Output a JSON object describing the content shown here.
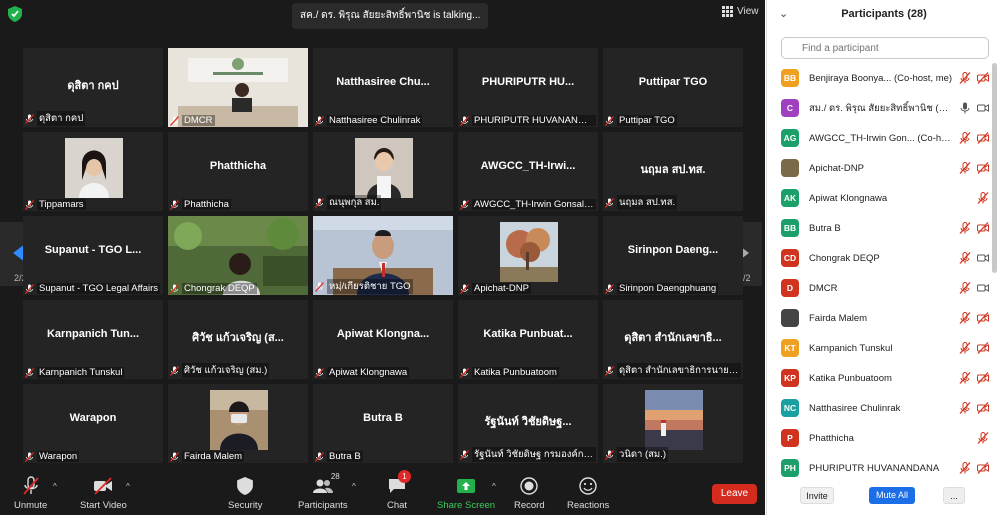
{
  "meeting": {
    "talking_text": "สค./ ดร. พิรุณ สัยยะสิทธิ์พานิช is  talking...",
    "view_label": "View",
    "page_left": "2/2",
    "page_right": "2/2"
  },
  "tiles": [
    {
      "big": "ดุสิตา กคป",
      "label": "ดุสิตา กคป",
      "video": false
    },
    {
      "big": "",
      "label": "DMCR",
      "video": "office"
    },
    {
      "big": "Natthasiree  Chu...",
      "label": "Natthasiree Chulinrak",
      "video": false
    },
    {
      "big": "PHURIPUTR  HU...",
      "label": "PHURIPUTR HUVANANDANA",
      "video": false
    },
    {
      "big": "Puttipar TGO",
      "label": "Puttipar TGO",
      "video": false
    },
    {
      "big": "",
      "label": "Tippamars",
      "video": "portrait"
    },
    {
      "big": "Phatthicha",
      "label": "Phatthicha",
      "video": false
    },
    {
      "big": "",
      "label": "ณนุพกุล สม.",
      "video": "portrait2"
    },
    {
      "big": "AWGCC_TH-Irwi...",
      "label": "AWGCC_TH-Irwin Gonsalves",
      "video": false
    },
    {
      "big": "นฤมล สป.ทส.",
      "label": "นฤมล สป.ทส.",
      "video": false
    },
    {
      "big": "Supanut - TGO L...",
      "label": "Supanut - TGO Legal Affairs",
      "video": false
    },
    {
      "big": "",
      "label": "Chongrak DEQP",
      "video": "garden"
    },
    {
      "big": "",
      "label": "หมฺ่/เกียรติชาย TGO",
      "video": "suit"
    },
    {
      "big": "",
      "label": "Apichat-DNP",
      "video": "tree"
    },
    {
      "big": "Sirinpon  Daeng...",
      "label": "Sirinpon Daengphuang",
      "video": false
    },
    {
      "big": "Karnpanich  Tun...",
      "label": "Karnpanich Tunskul",
      "video": false
    },
    {
      "big": "ศิวัช แก้วเจริญ (ส...",
      "label": "ศิวัช แก้วเจริญ (สม.)",
      "video": false
    },
    {
      "big": "Apiwat  Klongna...",
      "label": "Apiwat Klongnawa",
      "video": false
    },
    {
      "big": "Katika  Punbuat...",
      "label": "Katika Punbuatoom",
      "video": false
    },
    {
      "big": "ดุสิตา สำนักเลขาธิ...",
      "label": "ดุสิตา สำนักเลขาธิการนายกรัฐม...",
      "video": false
    },
    {
      "big": "Warapon",
      "label": "Warapon",
      "video": false
    },
    {
      "big": "",
      "label": "Fairda Malem",
      "video": "mask"
    },
    {
      "big": "Butra B",
      "label": "Butra B",
      "video": false
    },
    {
      "big": "รัฐนันท์ วิชัยดิษฐ...",
      "label": "รัฐนันท์ วิชัยดิษฐ กรมองค์การระ...",
      "video": false
    },
    {
      "big": "",
      "label": "วนิดา (สม.)",
      "video": "sunset"
    }
  ],
  "toolbar": {
    "unmute": "Unmute",
    "start_video": "Start Video",
    "security": "Security",
    "participants": "Participants",
    "participants_count": "28",
    "chat": "Chat",
    "chat_badge": "1",
    "share": "Share Screen",
    "record": "Record",
    "reactions": "Reactions",
    "leave": "Leave"
  },
  "panel": {
    "title": "Participants (28)",
    "search_placeholder": "Find a participant",
    "invite": "Invite",
    "mute_all": "Mute All",
    "more": "..."
  },
  "participants": [
    {
      "initials": "BB",
      "color": "#f0a020",
      "name": "Benjiraya Boonya...   (Co-host, me)",
      "mic": "off",
      "video": "off"
    },
    {
      "initials": "C",
      "color": "#a040c0",
      "name": "สม./ ดร. พิรุณ สัยยะสิทธิ์พานิช (Host)",
      "mic": "on",
      "video": "on"
    },
    {
      "initials": "AG",
      "color": "#1aa068",
      "name": "AWGCC_TH-Irwin Gon...   (Co-host)",
      "mic": "off",
      "video": "off"
    },
    {
      "initials": "",
      "color": "#7a6a4a",
      "name": "Apichat-DNP",
      "mic": "off",
      "video": "off"
    },
    {
      "initials": "AK",
      "color": "#1aa068",
      "name": "Apiwat Klongnawa",
      "mic": "off",
      "video": "none"
    },
    {
      "initials": "BB",
      "color": "#1aa068",
      "name": "Butra B",
      "mic": "off",
      "video": "off"
    },
    {
      "initials": "CD",
      "color": "#d0341e",
      "name": "Chongrak DEQP",
      "mic": "off",
      "video": "on"
    },
    {
      "initials": "D",
      "color": "#d0341e",
      "name": "DMCR",
      "mic": "off",
      "video": "on"
    },
    {
      "initials": "",
      "color": "#444444",
      "name": "Fairda Malem",
      "mic": "off",
      "video": "off"
    },
    {
      "initials": "KT",
      "color": "#f0a020",
      "name": "Karnpanich Tunskul",
      "mic": "off",
      "video": "off"
    },
    {
      "initials": "KP",
      "color": "#d0341e",
      "name": "Katika Punbuatoom",
      "mic": "off",
      "video": "off"
    },
    {
      "initials": "NC",
      "color": "#1aa0a0",
      "name": "Natthasiree Chulinrak",
      "mic": "off",
      "video": "off"
    },
    {
      "initials": "P",
      "color": "#d0341e",
      "name": "Phatthicha",
      "mic": "off",
      "video": "none"
    },
    {
      "initials": "PH",
      "color": "#1aa068",
      "name": "PHURIPUTR HUVANANDANA",
      "mic": "off",
      "video": "off"
    }
  ]
}
